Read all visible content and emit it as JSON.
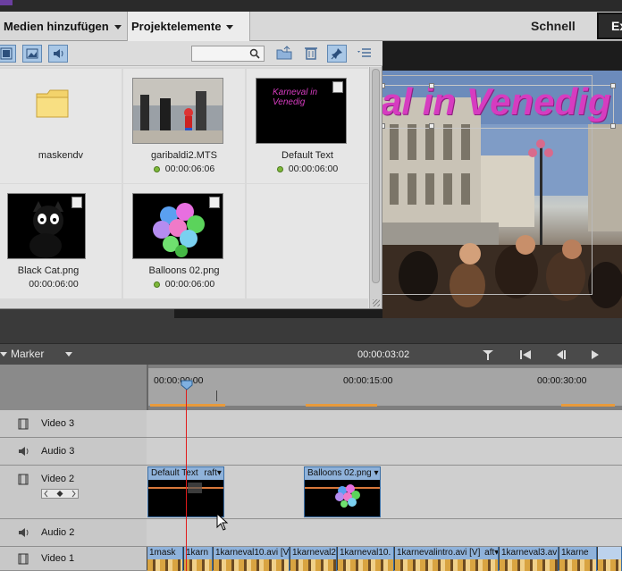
{
  "menu": {
    "add_media": "Medien hinzufügen",
    "project_assets": "Projektelemente",
    "quick": "Schnell",
    "expert": "Ex"
  },
  "panel": {
    "toolbar_icons": [
      "filmstrip-icon",
      "image-icon",
      "audio-icon",
      "search-icon",
      "folder-up-icon",
      "trash-icon",
      "pin-icon",
      "list-menu-icon"
    ],
    "search_value": "",
    "items": [
      {
        "name": "maskendv",
        "duration": "",
        "type": "folder"
      },
      {
        "name": "garibaldi2.MTS",
        "duration": "00:00:06:06",
        "type": "video"
      },
      {
        "name": "Default Text",
        "duration": "00:00:06:00",
        "type": "title",
        "thumb_text": "Karneval in Venedig"
      },
      {
        "name": "Black Cat.png",
        "duration": "00:00:06:00",
        "type": "image"
      },
      {
        "name": "Balloons 02.png",
        "duration": "00:00:06:00",
        "type": "image"
      }
    ]
  },
  "preview": {
    "title_text": "al in Venedig",
    "title_color": "#d63cc0"
  },
  "timeline": {
    "marker_label": "Marker",
    "timecode": "00:00:03:02",
    "ruler": [
      "00:00:00:00",
      "00:00:15:00",
      "00:00:30:00"
    ],
    "tracks": [
      {
        "name": "Video 3",
        "kind": "video"
      },
      {
        "name": "Audio 3",
        "kind": "audio"
      },
      {
        "name": "Video 2",
        "kind": "video"
      },
      {
        "name": "Audio 2",
        "kind": "audio"
      },
      {
        "name": "Video 1",
        "kind": "video"
      }
    ],
    "video2_clips": [
      {
        "label": "Default Text",
        "sub": "raft"
      },
      {
        "label": "Balloons 02.png"
      }
    ],
    "video1_clips": [
      "1mask",
      "1karn",
      "1karneval10.avi [V",
      "1karneval2",
      "1karneval10.",
      "1karnevalintro.avi [V]",
      "aft",
      "1karneval3.av",
      "1karne"
    ]
  },
  "colors": {
    "accent": "#8fb2da",
    "playhead": "#e01b1b",
    "workarea": "#e89a3b",
    "status_dot": "#7eb83a"
  }
}
